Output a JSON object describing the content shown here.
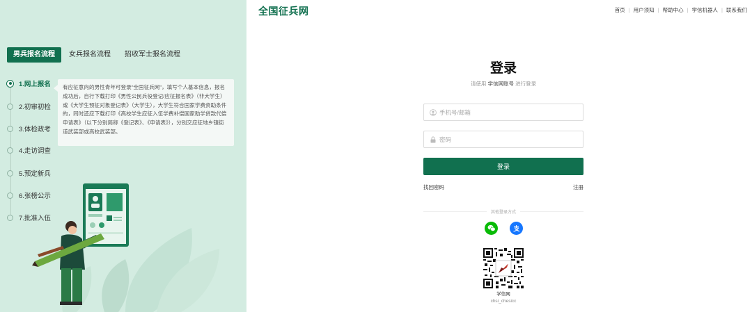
{
  "header": {
    "logo": "全国征兵网",
    "nav": [
      "首页",
      "用户须知",
      "帮助中心",
      "学信机器人",
      "联系我们"
    ]
  },
  "left_panel": {
    "tabs": [
      "男兵报名流程",
      "女兵报名流程",
      "招收军士报名流程"
    ],
    "active_tab": 0,
    "steps": [
      "1.网上报名",
      "2.初审初检",
      "3.体检政考",
      "4.走访调查",
      "5.预定新兵",
      "6.张榜公示",
      "7.批准入伍"
    ],
    "active_step": 0,
    "description": "有应征意向的男性青年可登录\"全国征兵网\"，填写个人基本信息，报名成功后，自行下载打印《男性公民兵役登记/应征报名表》（非大学生）或《大学生预征对象登记表》（大学生），大学生符合国家学费资助条件的，同时还应下载打印《高校学生应征入伍学费补偿国家助学贷款代偿申请表》（以下分别简称《登记表》、《申请表》），分别交应征地乡镇街道武装部或高校武装部。"
  },
  "login": {
    "title": "登录",
    "subtitle_pre": "请使用",
    "subtitle_bold": "学信网账号",
    "subtitle_post": "进行登录",
    "username_placeholder": "手机号/邮箱",
    "password_placeholder": "密码",
    "submit_label": "登录",
    "forgot_label": "找回密码",
    "register_label": "注册",
    "other_login_label": "其他登录方式",
    "qr_caption": "学信网",
    "qr_sub": "chsi_chesicc"
  },
  "colors": {
    "brand_green": "#11704f",
    "panel_bg": "#d3ece1",
    "wechat": "#09bb07",
    "alipay": "#1677ff"
  },
  "icons": [
    "user-icon",
    "lock-icon",
    "wechat-icon",
    "alipay-icon",
    "qr-code"
  ]
}
